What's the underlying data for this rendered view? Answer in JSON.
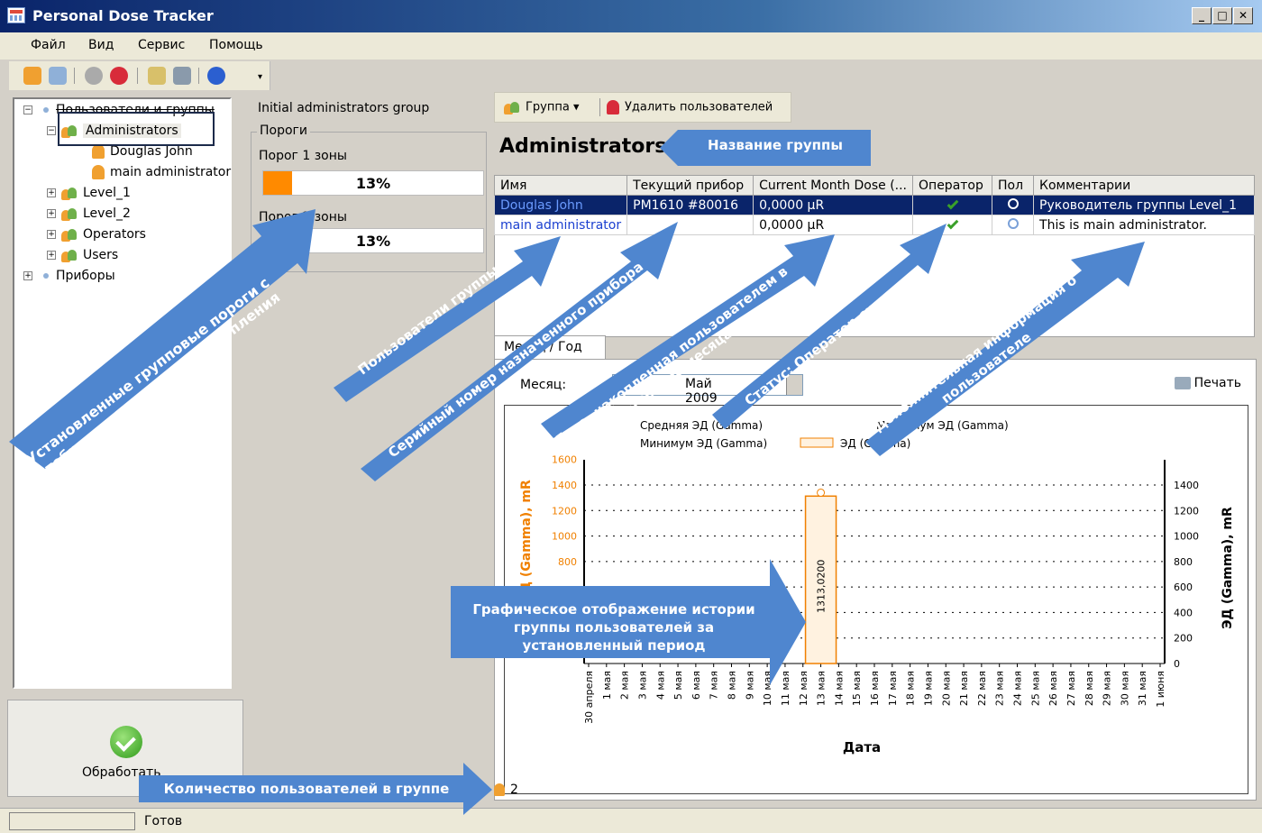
{
  "window": {
    "title": "Personal Dose Tracker",
    "buttons": [
      "_",
      "□",
      "✕"
    ]
  },
  "menu": [
    "Файл",
    "Вид",
    "Сервис",
    "Помощь"
  ],
  "toolbar": {
    "icons": [
      "add-group-icon",
      "add-user-icon",
      "shield-icon",
      "shield-remove-icon",
      "edit-icon",
      "device-icon",
      "help-icon"
    ],
    "overflow": "▾"
  },
  "tree": {
    "root": "Пользователи и группы",
    "groups": [
      {
        "label": "Administrators",
        "expanded": true,
        "children": [
          "Douglas John",
          "main administrator"
        ]
      },
      {
        "label": "Level_1"
      },
      {
        "label": "Level_2"
      },
      {
        "label": "Operators"
      },
      {
        "label": "Users"
      }
    ],
    "devices": "Приборы"
  },
  "process_button": "Обработать",
  "status": "Готов",
  "group_panel": {
    "description": "Initial administrators group",
    "thresholds_title": "Пороги",
    "threshold1_label": "Порог 1 зоны",
    "threshold1_pct": "13%",
    "threshold1_fill": 0.13,
    "threshold2_label": "Порог 2 зоны",
    "threshold2_pct": "13%",
    "threshold2_fill": 0.13
  },
  "right_toolbar": {
    "group_btn": "Группа",
    "delete_btn": "Удалить пользователей"
  },
  "group_title": "Administrators",
  "table": {
    "headers": [
      "Имя",
      "Текущий прибор",
      "Current Month Dose (...",
      "Оператор",
      "Пол",
      "Комментарии"
    ],
    "rows": [
      {
        "name": "Douglas John",
        "device": "PM1610 #80016",
        "dose": "0,0000 µR",
        "comment": "Руководитель группы Level_1"
      },
      {
        "name": "main administrator",
        "device": "",
        "dose": "0,0000 µR",
        "comment": "This is main administrator."
      }
    ]
  },
  "tab": "Месяц / Год",
  "month_label": "Месяц:",
  "month_value": "Май 2009",
  "print": "Печать",
  "user_count": "2",
  "chart_data": {
    "type": "bar",
    "title": "",
    "xlabel": "Дата",
    "ylabel_left": "ЭД (Gamma), mR",
    "ylabel_right": "ЭД (Gamma), mR",
    "legend": [
      "Средняя ЭД (Gamma)",
      "Максимум ЭД (Gamma)",
      "Минимум ЭД (Gamma)",
      "ЭД (Gamma)"
    ],
    "categories": [
      "30 апреля",
      "1 мая",
      "2 мая",
      "3 мая",
      "4 мая",
      "5 мая",
      "6 мая",
      "7 мая",
      "8 мая",
      "9 мая",
      "10 мая",
      "11 мая",
      "12 мая",
      "13 мая",
      "14 мая",
      "15 мая",
      "16 мая",
      "17 мая",
      "18 мая",
      "19 мая",
      "20 мая",
      "21 мая",
      "22 мая",
      "23 мая",
      "24 мая",
      "25 мая",
      "26 мая",
      "27 мая",
      "28 мая",
      "29 мая",
      "30 мая",
      "31 мая",
      "1 июня"
    ],
    "bars": [
      {
        "category": "13 мая",
        "value": 1313.02,
        "label": "1313,0200"
      }
    ],
    "max_marker": {
      "category": "13 мая",
      "value": 1340
    },
    "y_left_ticks": [
      800,
      1000,
      1200,
      1400,
      1600
    ],
    "y_right_ticks": [
      0,
      200,
      400,
      600,
      800,
      1000,
      1200,
      1400
    ],
    "ylim": [
      0,
      1600
    ],
    "grid": true,
    "legend_position": "top"
  },
  "callouts": {
    "thresholds": "Установленные групповые пороги с отображением степени накопления",
    "users": "Пользователи группы",
    "serial": "Серийный номер назначенного прибора",
    "dose": "Доза, накопленная пользователем в течение месяца",
    "operator": "Статус: Оператор системы",
    "info": "Дополнительная информация о пользователе",
    "group_name": "Название группы",
    "chart": "Графическое отображение истории группы пользователей за установленный период",
    "count": "Количество пользователей в группе"
  },
  "colors": {
    "accent": "#4f86cf",
    "bar": "#ff8a00",
    "selection": "#0a246a"
  }
}
